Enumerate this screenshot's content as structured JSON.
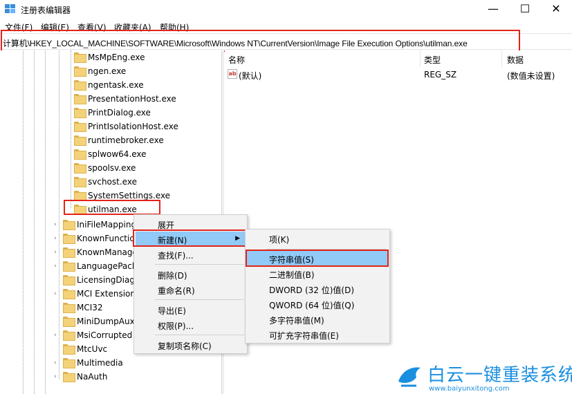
{
  "window": {
    "title": "注册表编辑器",
    "icon": "regedit-icon",
    "minimize": "—",
    "maximize": "☐",
    "close": "✕"
  },
  "menu": [
    "文件(F)",
    "编辑(E)",
    "查看(V)",
    "收藏夹(A)",
    "帮助(H)"
  ],
  "address": "计算机\\HKEY_LOCAL_MACHINE\\SOFTWARE\\Microsoft\\Windows NT\\CurrentVersion\\Image File Execution Options\\utilman.exe",
  "tree": {
    "children": [
      "MsMpEng.exe",
      "ngen.exe",
      "ngentask.exe",
      "PresentationHost.exe",
      "PrintDialog.exe",
      "PrintIsolationHost.exe",
      "runtimebroker.exe",
      "splwow64.exe",
      "spoolsv.exe",
      "svchost.exe",
      "SystemSettings.exe",
      "utilman.exe"
    ],
    "siblings": [
      "IniFileMapping",
      "KnownFunctio",
      "KnownManage",
      "LanguagePack",
      "LicensingDiag",
      "MCI Extension",
      "MCI32",
      "MiniDumpAux",
      "MsiCorrupted",
      "MtcUvc",
      "Multimedia",
      "NaAuth"
    ]
  },
  "list": {
    "headers": [
      "名称",
      "类型",
      "数据"
    ],
    "rows": [
      {
        "name": "(默认)",
        "type": "REG_SZ",
        "data": "(数值未设置)"
      }
    ]
  },
  "context_menu": {
    "items": [
      "展开",
      "新建(N)",
      "查找(F)...",
      "删除(D)",
      "重命名(R)",
      "导出(E)",
      "权限(P)...",
      "复制项名称(C)"
    ]
  },
  "submenu": {
    "items": [
      "项(K)",
      "字符串值(S)",
      "二进制值(B)",
      "DWORD (32 位)值(D)",
      "QWORD (64 位)值(Q)",
      "多字符串值(M)",
      "可扩充字符串值(E)"
    ]
  },
  "watermark": {
    "title": "白云一键重装系统",
    "url": "www.baiyunxitong.com"
  },
  "colors": {
    "highlight": "#91c9f7",
    "annotation_red": "#e2231a",
    "brand_blue": "#1a8fe0",
    "folder": "#f4d27a"
  }
}
